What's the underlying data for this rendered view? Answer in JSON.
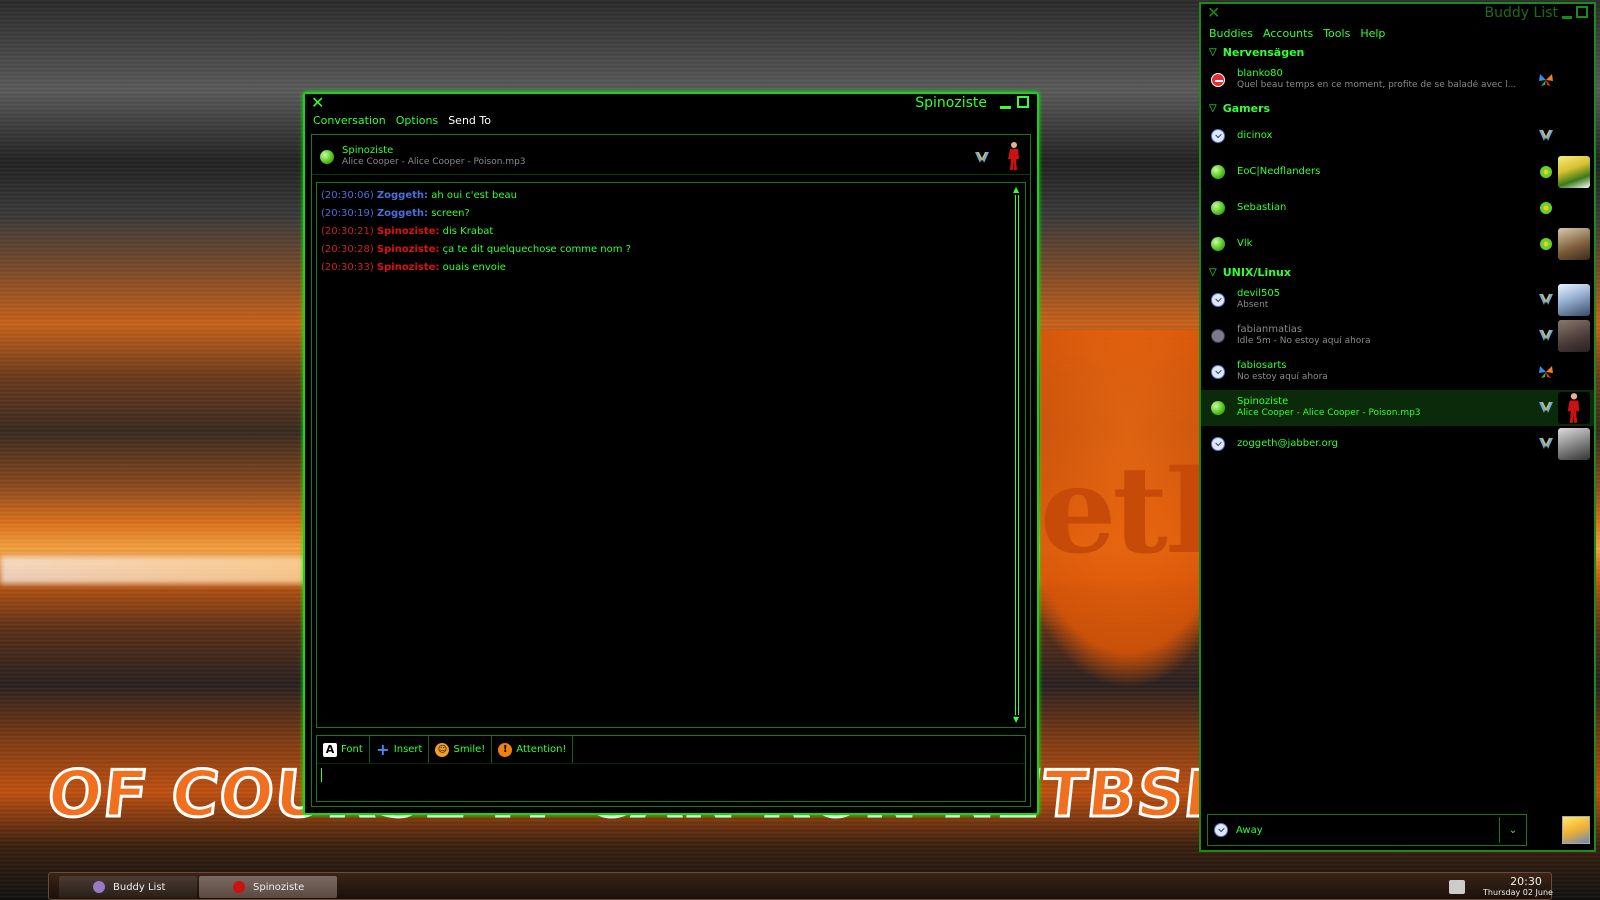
{
  "wallpaper": {
    "slogan": "OF COURSE IT CAN RUN NETBSD!",
    "logo_text": "etB"
  },
  "conversation": {
    "title": "Spinoziste",
    "menu": [
      "Conversation",
      "Options",
      "Send To"
    ],
    "buddy_name": "Spinoziste",
    "buddy_status": "Alice Cooper - Alice Cooper - Poison.mp3",
    "messages": [
      {
        "time": "(20:30:06)",
        "nick": "Zoggeth:",
        "text": "ah oui c'est beau",
        "color": "blue"
      },
      {
        "time": "(20:30:19)",
        "nick": "Zoggeth:",
        "text": "screen?",
        "color": "blue"
      },
      {
        "time": "(20:30:21)",
        "nick": "Spinoziste:",
        "text": "dis Krabat",
        "color": "red"
      },
      {
        "time": "(20:30:28)",
        "nick": "Spinoziste:",
        "text": "ça te dit quelquechose comme nom ?",
        "color": "red"
      },
      {
        "time": "(20:30:33)",
        "nick": "Spinoziste:",
        "text": "ouais envoie",
        "color": "red"
      }
    ],
    "toolbar": {
      "font": "Font",
      "insert": "Insert",
      "smile": "Smile!",
      "attention": "Attention!"
    }
  },
  "buddy_list": {
    "title": "Buddy List",
    "menu": [
      "Buddies",
      "Accounts",
      "Tools",
      "Help"
    ],
    "groups": [
      {
        "name": "Nervensägen",
        "buddies": [
          {
            "name": "blanko80",
            "sub": "Quel beau temps en ce moment, profite de se baladé avec l...",
            "status": "busy",
            "proto": "msn"
          }
        ]
      },
      {
        "name": "Gamers",
        "buddies": [
          {
            "name": "dicinox",
            "sub": "",
            "status": "away",
            "proto": "jabber"
          },
          {
            "name": "EoC|Nedflanders",
            "sub": "",
            "status": "available",
            "proto": "icq",
            "avatar": "av1"
          },
          {
            "name": "Sebastian",
            "sub": "",
            "status": "available",
            "proto": "icq"
          },
          {
            "name": "Vlk",
            "sub": "",
            "status": "available",
            "proto": "icq",
            "avatar": "av2"
          }
        ]
      },
      {
        "name": "UNIX/Linux",
        "buddies": [
          {
            "name": "devil505",
            "sub": "Absent",
            "status": "away",
            "proto": "jabber",
            "avatar": "av3"
          },
          {
            "name": "fabianmatias",
            "sub": "Idle 5m - No estoy aquí ahora",
            "status": "idle",
            "proto": "jabber",
            "avatar": "av4"
          },
          {
            "name": "fabiosarts",
            "sub": "No estoy aquí ahora",
            "status": "away",
            "proto": "msn"
          },
          {
            "name": "Spinoziste",
            "sub": "Alice Cooper - Alice Cooper - Poison.mp3",
            "status": "available",
            "proto": "jabber",
            "avatar": "av5",
            "selected": true
          },
          {
            "name": "zoggeth@jabber.org",
            "sub": "",
            "status": "away",
            "proto": "jabber",
            "avatar": "av6"
          }
        ]
      }
    ],
    "my_status": "Away"
  },
  "taskbar": {
    "tasks": [
      "Buddy List",
      "Spinoziste"
    ],
    "time": "20:30",
    "date": "Thursday 02 June"
  }
}
